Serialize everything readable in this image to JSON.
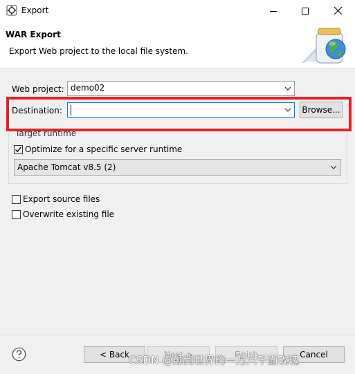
{
  "window": {
    "title": "Export",
    "minimize_icon": "minimize-icon",
    "maximize_icon": "maximize-icon",
    "close_icon": "close-icon"
  },
  "header": {
    "title": "WAR Export",
    "description": "Export Web project to the local file system."
  },
  "form": {
    "web_project_label": "Web project:",
    "web_project_value": "demo02",
    "destination_label": "Destination:",
    "destination_value": "",
    "browse_label": "Browse...",
    "target_runtime_label": "Target runtime",
    "optimize_label": "Optimize for a specific server runtime",
    "optimize_checked": true,
    "runtime_value": "Apache Tomcat v8.5 (2)",
    "export_source_label": "Export source files",
    "export_source_checked": false,
    "overwrite_label": "Overwrite existing file",
    "overwrite_checked": false
  },
  "footer": {
    "back_label": "< Back",
    "next_label": "Next >",
    "finish_label": "Finish",
    "cancel_label": "Cancel"
  },
  "watermark": "CSDN @颠倒世界的一万六千面玫瑰",
  "colors": {
    "highlight": "#e8212a",
    "header_bg": "#ffffff",
    "dialog_bg": "#f0f0f0"
  }
}
